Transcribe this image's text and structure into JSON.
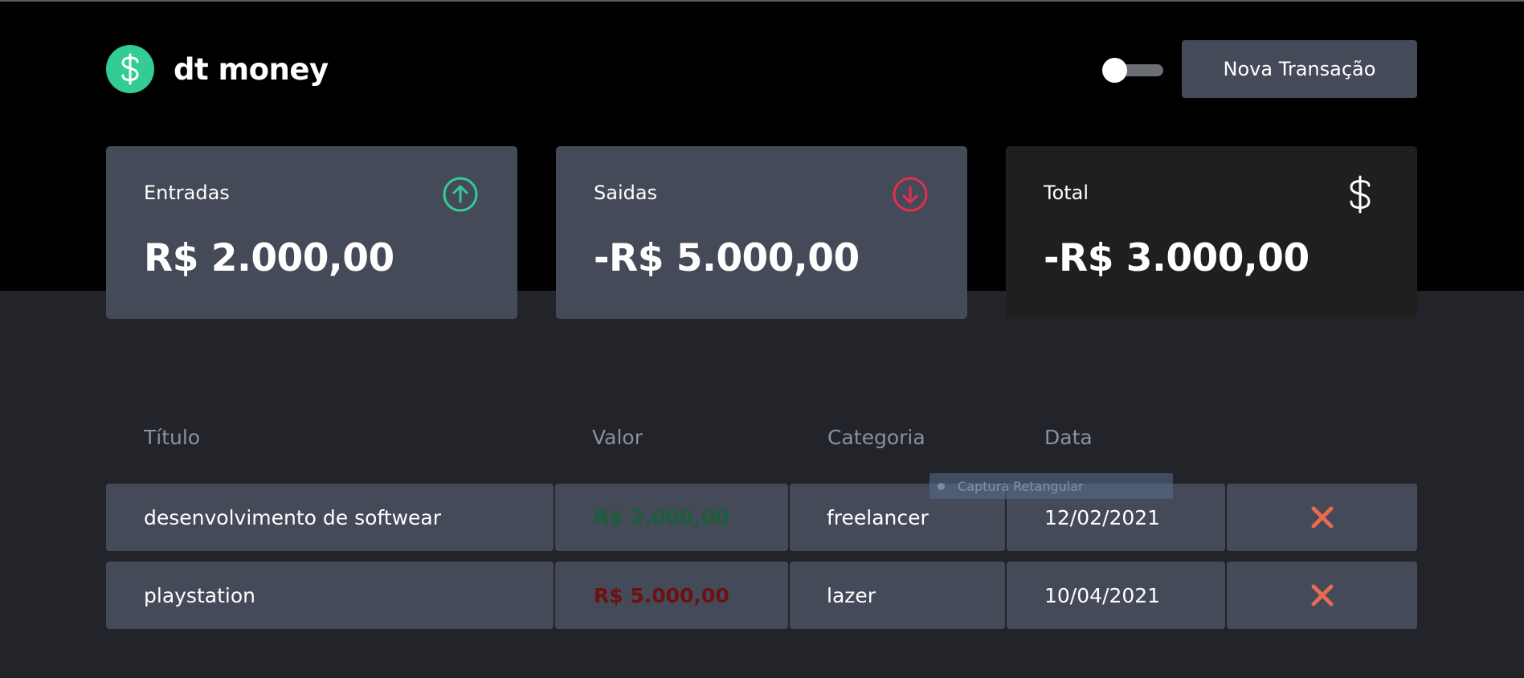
{
  "header": {
    "app_name": "dt money",
    "new_transaction_label": "Nova Transação",
    "theme_toggle_state": "off"
  },
  "summary": {
    "income": {
      "label": "Entradas",
      "value": "R$ 2.000,00",
      "icon": "arrow-circle-up-icon",
      "color": "#33cc95"
    },
    "outcome": {
      "label": "Saidas",
      "value": "-R$ 5.000,00",
      "icon": "arrow-circle-down-icon",
      "color": "#e52e4d"
    },
    "total": {
      "label": "Total",
      "value": "-R$ 3.000,00",
      "icon": "dollar-sign-icon",
      "color": "#ffffff"
    }
  },
  "table": {
    "headers": [
      "Título",
      "Valor",
      "Categoria",
      "Data"
    ],
    "rows": [
      {
        "title": "desenvolvimento de softwear",
        "value": "R$ 2.000,00",
        "type": "deposit",
        "category": "freelancer",
        "date": "12/02/2021"
      },
      {
        "title": "playstation",
        "value": "R$ 5.000,00",
        "type": "withdraw",
        "category": "lazer",
        "date": "10/04/2021"
      }
    ]
  },
  "overlay": {
    "capture_label": "Captura Retangular"
  },
  "colors": {
    "background": "#232429",
    "header_bg": "#000000",
    "card_bg": "#444a58",
    "total_card_bg": "#1d201e",
    "accent_green": "#33cc95",
    "delete_red": "#e86a4f"
  }
}
